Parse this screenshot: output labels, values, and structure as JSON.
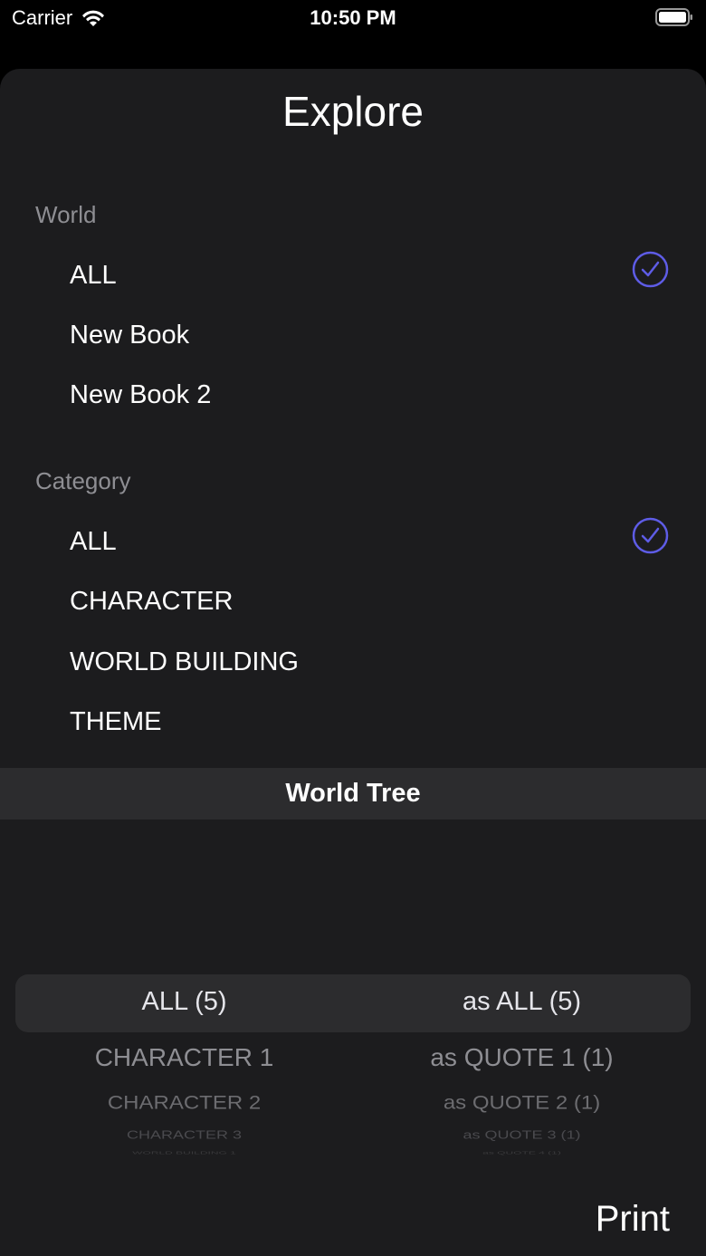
{
  "status": {
    "carrier": "Carrier",
    "time": "10:50 PM"
  },
  "sheet": {
    "title": "Explore",
    "world": {
      "header": "World",
      "items": [
        {
          "label": "ALL",
          "selected": true
        },
        {
          "label": "New Book",
          "selected": false
        },
        {
          "label": "New Book 2",
          "selected": false
        }
      ]
    },
    "category": {
      "header": "Category",
      "items": [
        {
          "label": "ALL",
          "selected": true
        },
        {
          "label": "CHARACTER",
          "selected": false
        },
        {
          "label": "WORLD BUILDING",
          "selected": false
        },
        {
          "label": "THEME",
          "selected": false
        }
      ]
    },
    "world_tree": "World Tree",
    "picker": {
      "left": [
        "ALL (5)",
        "CHARACTER 1",
        "CHARACTER 2",
        "CHARACTER 3",
        "WORLD BUILDING 1"
      ],
      "right": [
        "as ALL (5)",
        "as QUOTE 1 (1)",
        "as QUOTE 2 (1)",
        "as QUOTE 3 (1)",
        "as QUOTE 4 (1)"
      ]
    },
    "print_label": "Print"
  },
  "colors": {
    "accent": "#5e5ce6",
    "sheet_bg": "#1c1c1e",
    "secondary_text": "#8e8e93"
  }
}
